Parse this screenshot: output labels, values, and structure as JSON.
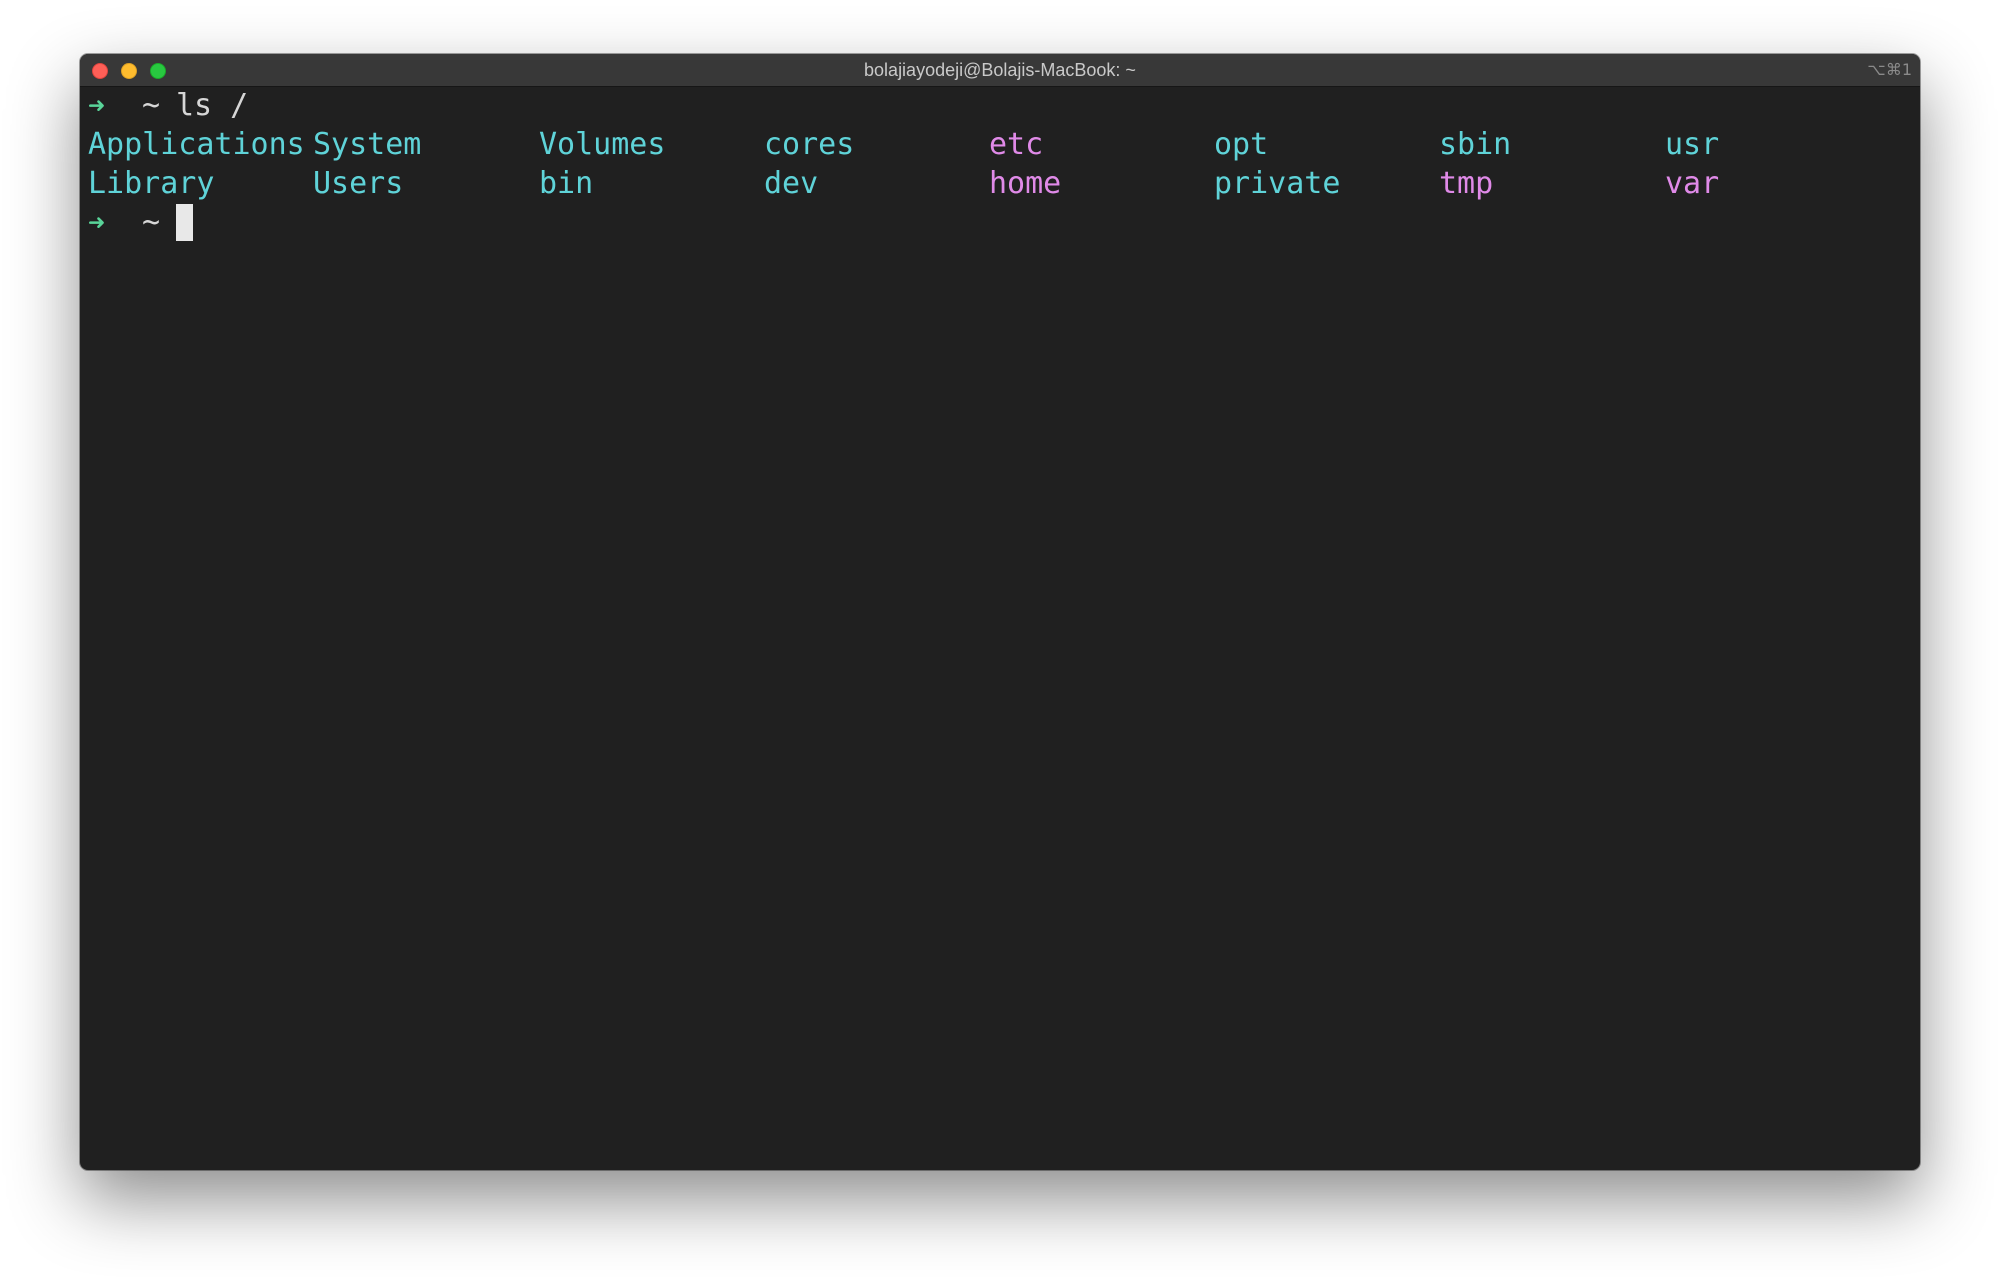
{
  "window": {
    "title": "bolajiayodeji@Bolajis-MacBook: ~",
    "shortcut": "⌥⌘1"
  },
  "colors": {
    "background": "#202020",
    "prompt_arrow": "#59d499",
    "directory": "#5fd3d8",
    "symlink": "#e08ae8",
    "text": "#d6d6d6"
  },
  "terminal": {
    "prompt_arrow": "➜",
    "prompt_dir": "~",
    "command": "ls /",
    "listing": {
      "row1": [
        "Applications",
        "System",
        "Volumes",
        "cores",
        "etc",
        "opt",
        "sbin",
        "usr"
      ],
      "row2": [
        "Library",
        "Users",
        "bin",
        "dev",
        "home",
        "private",
        "tmp",
        "var"
      ]
    }
  }
}
